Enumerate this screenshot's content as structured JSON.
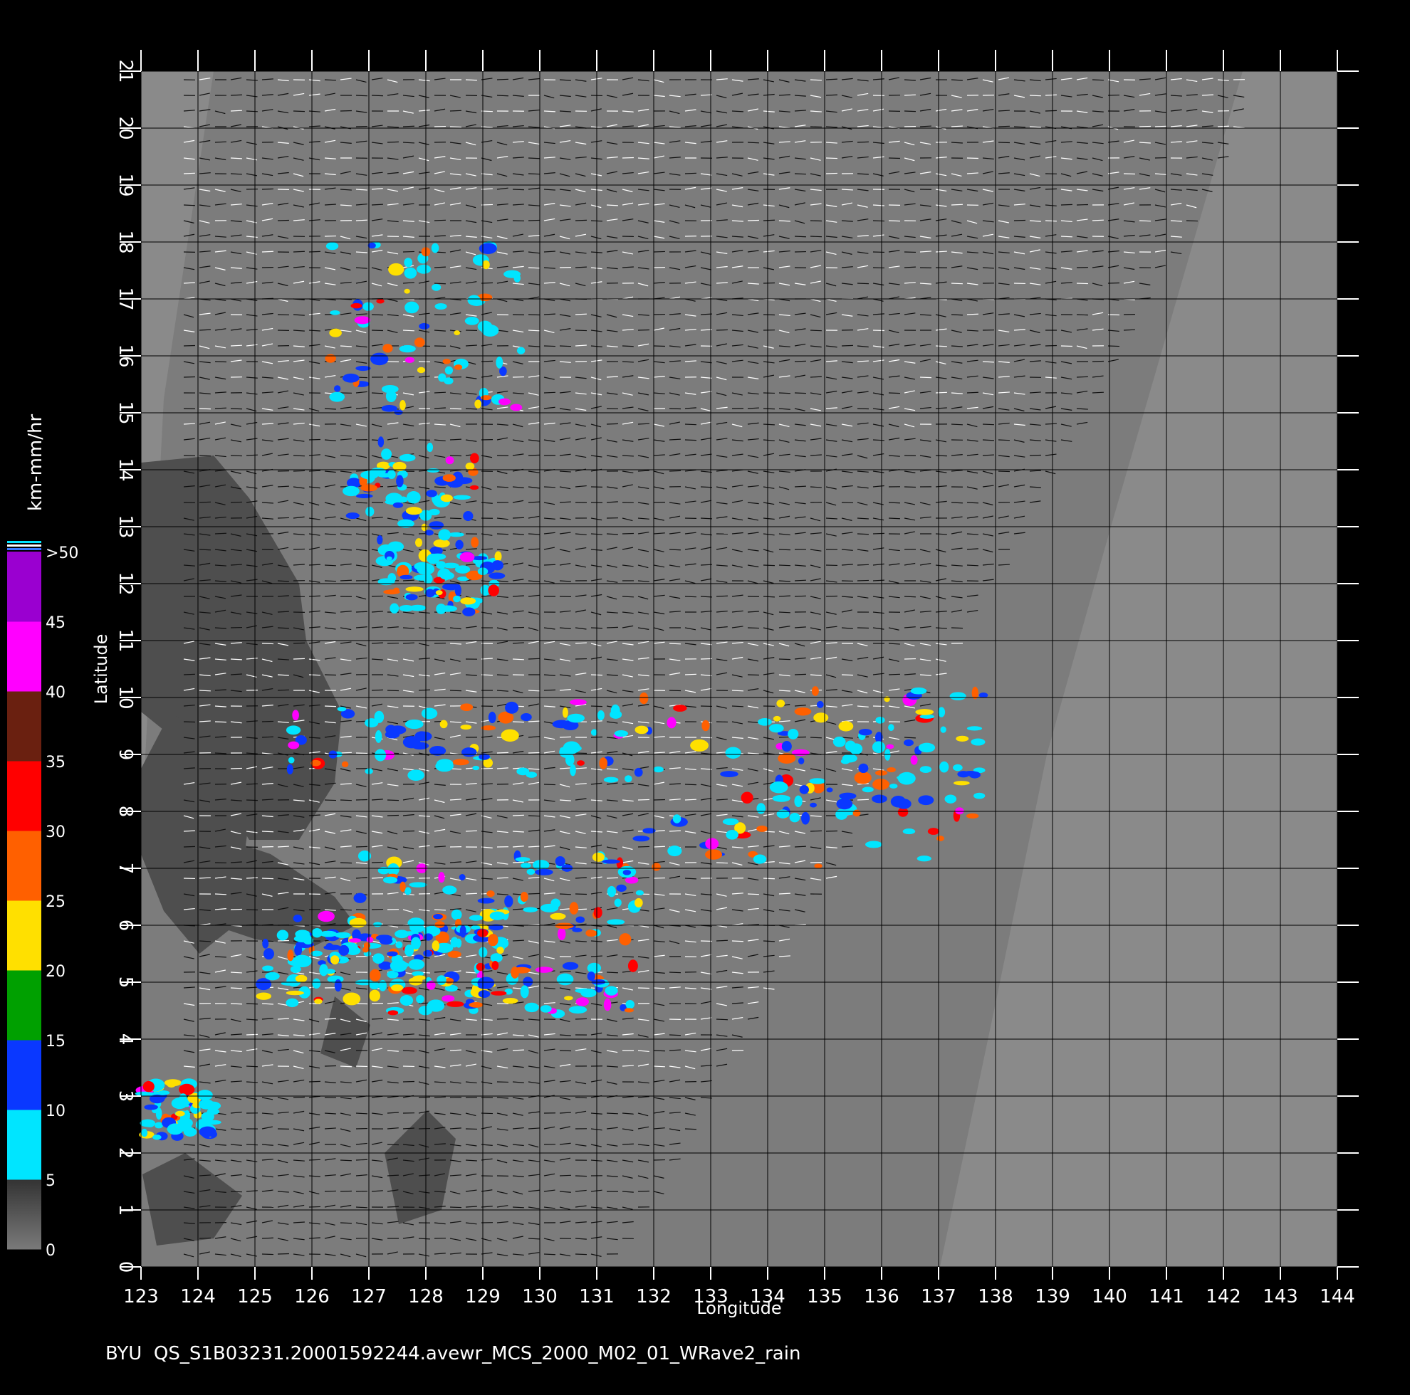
{
  "figure": {
    "footer_text": "BYU  QS_S1B03231.20001592244.avewr_MCS_2000_M02_01_WRave2_rain",
    "xlabel": "Longitude",
    "ylabel": "Latitude",
    "x_ticks": [
      "123",
      "124",
      "125",
      "126",
      "127",
      "128",
      "129",
      "130",
      "131",
      "132",
      "133",
      "134",
      "135",
      "136",
      "137",
      "138",
      "139",
      "140",
      "141",
      "142",
      "143",
      "144"
    ],
    "y_ticks": [
      "0",
      "1",
      "2",
      "3",
      "4",
      "5",
      "6",
      "7",
      "8",
      "9",
      "10",
      "11",
      "12",
      "13",
      "14",
      "15",
      "16",
      "17",
      "18",
      "19",
      "20",
      "21"
    ],
    "xlim": [
      123,
      144
    ],
    "ylim": [
      0,
      21
    ],
    "grid": true
  },
  "colorbar": {
    "unit_label": "km-mm/hr",
    "tick_labels": [
      "0",
      "5",
      "10",
      "15",
      "20",
      "25",
      "30",
      "35",
      "40",
      "45",
      ">50"
    ],
    "colors": [
      "#4a4a4a",
      "#00e5ff",
      "#0a38ff",
      "#00a000",
      "#ffe000",
      "#ff6000",
      "#ff0000",
      "#6a2010",
      "#ff00ff",
      "#9a00d0"
    ]
  },
  "colors": {
    "background": "#000000",
    "map_gray": "#8a8a8a",
    "swath_gray": "#7c7c7c",
    "land_dark": "#4e4e4e",
    "grid_line": "#000000",
    "wind_white": "#ffffff",
    "wind_black": "#111111"
  }
}
